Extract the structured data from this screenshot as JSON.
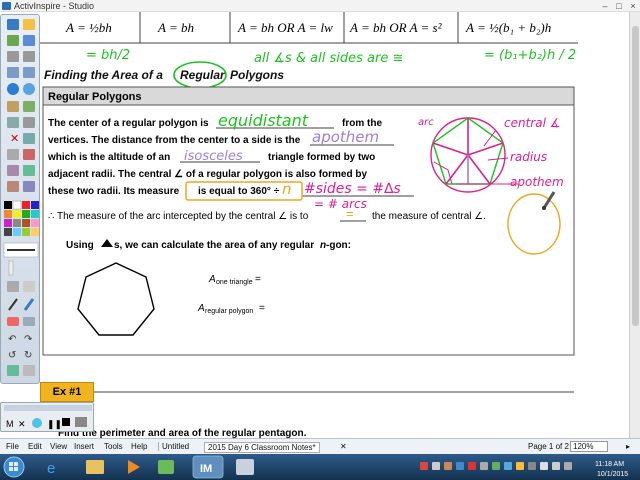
{
  "window": {
    "title": "ActivInspire - Studio"
  },
  "formulas": [
    "A = ½bh",
    "A = bh",
    "A = bh OR A = lw",
    "A = bh OR A = s²",
    "A = ½(b₁ + b₂)h"
  ],
  "ink_top": {
    "left": "= bh/2",
    "center": "all ∡s & all sides are ≅",
    "right": "= (b₁+b₂)h / 2"
  },
  "heading": {
    "part1": "Finding the Area of a",
    "regular": "Regular",
    "part2": "Polygons"
  },
  "section_title": "Regular Polygons",
  "para": {
    "l1a": "The center of a regular polygon is",
    "l1b": "from the",
    "l2a": "vertices.  The distance from the center to a side is the",
    "l3a": "which is the altitude of an",
    "l3b": "triangle formed by two",
    "l4": "adjacent radii.  The central ∠ of a regular polygon is also formed by",
    "l5a": "these two radii.  Its measure",
    "l5b": "is equal to 360° ÷"
  },
  "ink_answers": {
    "equidistant": "equidistant",
    "apothem": "apothem",
    "isosceles": "isosceles",
    "n": "n",
    "sides": "#sides = #∆s",
    "arcs": "= # arcs"
  },
  "arc_line": {
    "a": "∴  The measure of the arc intercepted by the central ∠ is to",
    "b": "the measure of central ∠."
  },
  "ink_equal": "=",
  "using": {
    "a": "Using",
    "b": "s, we can calculate the area of any regular",
    "c": "n",
    "d": "-gon:"
  },
  "area_one": {
    "a": "A",
    "b": "one triangle",
    "c": " ="
  },
  "area_poly": {
    "a": "A",
    "b": "regular polygon",
    "c": " ="
  },
  "ink_labels": {
    "arc": "arc",
    "central": "central ∡",
    "radius": "radius",
    "apothem": "apothem"
  },
  "example": {
    "label": "Ex #1",
    "question": "Find the perimeter and area of the regular pentagon."
  },
  "menus": [
    "File",
    "Edit",
    "View",
    "Insert",
    "Tools",
    "Help"
  ],
  "tabs": [
    "Untitled",
    "2015 Day 6 Classroom Notes*"
  ],
  "page": "Page 1 of 2",
  "zoom": "120%",
  "clock": {
    "time": "11:18 AM",
    "date": "10/1/2015"
  },
  "colors": {
    "ink_green": "#19c41f",
    "ink_magenta": "#e0208a",
    "ink_lavender": "#9c7fe0",
    "ink_orange": "#f2a51e",
    "header_gray": "#d9d9d9"
  }
}
